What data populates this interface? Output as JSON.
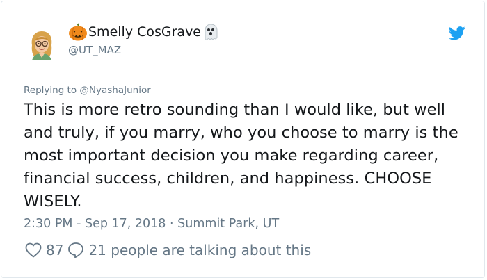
{
  "author": {
    "display_name": "Smelly CosGrave",
    "handle": "@UT_MAZ"
  },
  "reply_to": {
    "prefix": "Replying to",
    "handle": "@NyashaJunior"
  },
  "tweet": {
    "text": "This is more retro sounding than I would like, but well and truly, if you marry, who you choose to marry is the most important decision you make regarding career, financial success, children, and happiness. CHOOSE WISELY."
  },
  "meta": {
    "time": "2:30 PM",
    "sep1": " - ",
    "date": "Sep 17, 2018",
    "sep2": " · ",
    "location": "Summit Park, UT"
  },
  "actions": {
    "likes": "87",
    "comments_text": "21 people are talking about this"
  },
  "colors": {
    "text": "#14171a",
    "muted": "#657786",
    "twitter_blue": "#1da1f2",
    "border": "#e1e8ed"
  },
  "icons": {
    "name_prefix": "jack-o-lantern-icon",
    "name_suffix": "ghost-icon",
    "brand": "twitter-bird-icon",
    "like": "heart-icon",
    "reply": "speech-bubble-icon"
  }
}
